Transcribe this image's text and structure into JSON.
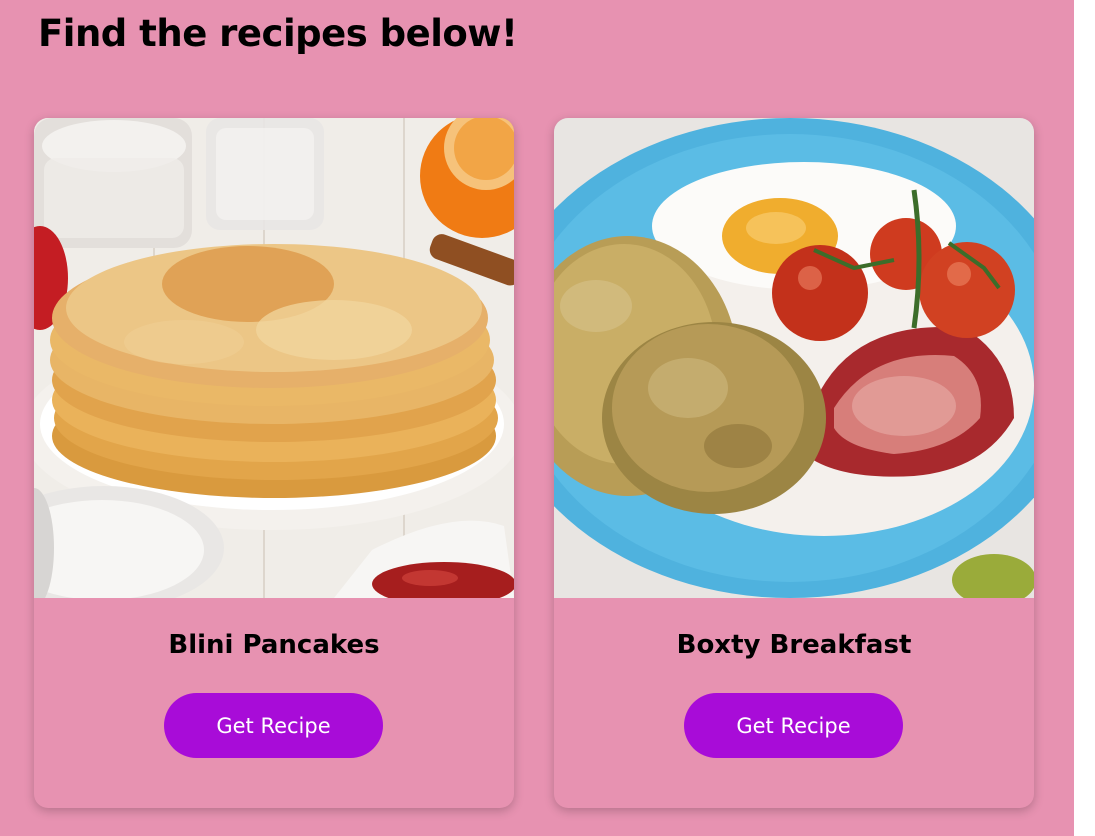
{
  "header": {
    "title": "Find the recipes below!"
  },
  "recipes": [
    {
      "title": "Blini Pancakes",
      "button_label": "Get Recipe",
      "image_icon": "pancakes-image"
    },
    {
      "title": "Boxty Breakfast",
      "button_label": "Get Recipe",
      "image_icon": "breakfast-image"
    }
  ],
  "colors": {
    "background": "#e792b1",
    "button": "#a80cd8",
    "button_text": "#ffffff",
    "text": "#000000"
  }
}
